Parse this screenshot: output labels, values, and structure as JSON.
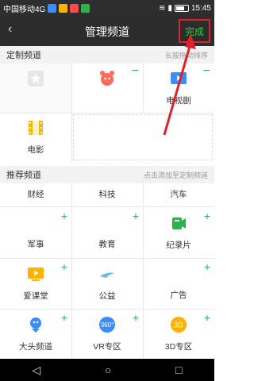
{
  "status_bar": {
    "carrier": "中国移动4G",
    "time": "15:45"
  },
  "header": {
    "back_icon": "back-chevron-icon",
    "title": "管理频道",
    "done_label": "完成"
  },
  "my_channels": {
    "section_label": "定制频道",
    "hint": "长按拖动排序",
    "items": [
      {
        "label": "",
        "icon": "star-icon"
      },
      {
        "label": "",
        "icon": "alarm-clock-icon"
      },
      {
        "label": "电视剧",
        "icon": "tv-icon"
      },
      {
        "label": "电影",
        "icon": "film-icon"
      }
    ]
  },
  "recommended": {
    "section_label": "推荐频道",
    "hint": "点击添加至定制频道",
    "items": [
      {
        "label": "财经"
      },
      {
        "label": "科技"
      },
      {
        "label": "汽车"
      },
      {
        "label": "军事"
      },
      {
        "label": "教育"
      },
      {
        "label": "纪录片"
      },
      {
        "label": "爱课堂"
      },
      {
        "label": "公益"
      },
      {
        "label": "广告"
      },
      {
        "label": "大头频道"
      },
      {
        "label": "VR专区"
      },
      {
        "label": "3D专区"
      }
    ]
  },
  "annotation_color": "#e0202a",
  "accent_color": "#2db24a"
}
